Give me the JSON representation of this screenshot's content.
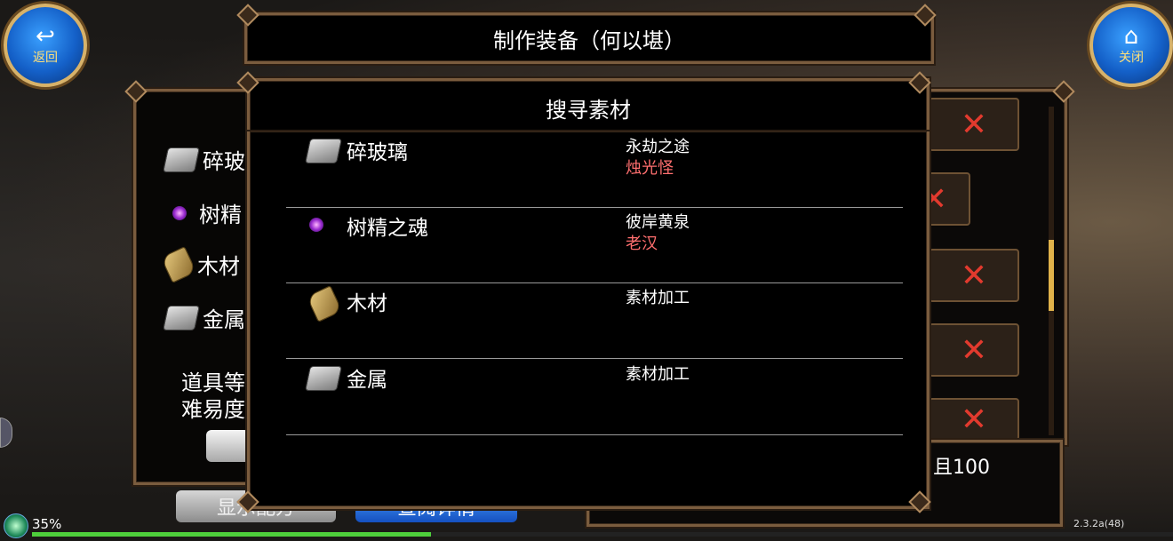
{
  "header": {
    "title": "制作装备（何以堪）"
  },
  "nav": {
    "back_label": "返回",
    "close_label": "关闭"
  },
  "left_panel": {
    "items": [
      {
        "label": "碎玻",
        "icon": "metal-icon"
      },
      {
        "label": "树精",
        "icon": "soul-orb-icon"
      },
      {
        "label": "木材",
        "icon": "wood-icon"
      },
      {
        "label": "金属",
        "icon": "metal-icon"
      }
    ],
    "desc_line1": "道具等",
    "desc_line2": "难易度"
  },
  "modal": {
    "title": "搜寻素材",
    "rows": [
      {
        "name": "碎玻璃",
        "icon": "metal-icon",
        "location": "永劫之途",
        "monster": "烛光怪"
      },
      {
        "name": "树精之魂",
        "icon": "soul-orb-icon",
        "location": "彼岸黄泉",
        "monster": "老汉"
      },
      {
        "name": "木材",
        "icon": "wood-icon",
        "location": "素材加工",
        "monster": ""
      },
      {
        "name": "金属",
        "icon": "metal-icon",
        "location": "素材加工",
        "monster": ""
      }
    ]
  },
  "bottom": {
    "info_text": "且100",
    "show_recipe_label": "显示配方",
    "view_details_label": "查阅详情",
    "remove_symbol": "✕"
  },
  "status": {
    "battery": "35%",
    "battery_level": 0.35,
    "version": "2.3.2a(48)"
  }
}
